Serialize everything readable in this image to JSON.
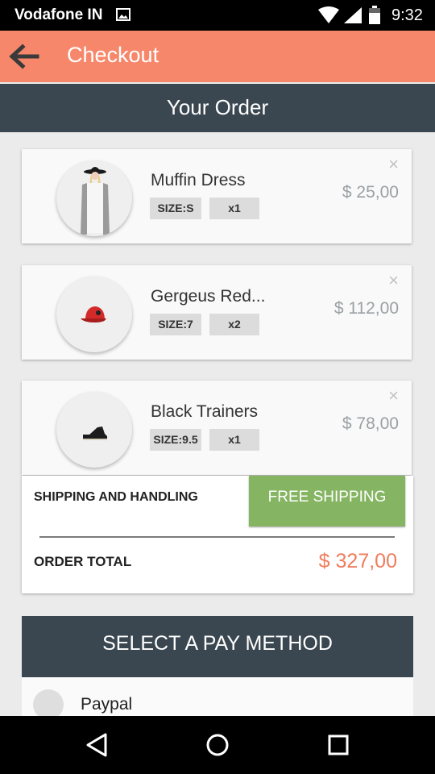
{
  "status_bar": {
    "carrier": "Vodafone IN",
    "time": "9:32"
  },
  "app_bar": {
    "title": "Checkout"
  },
  "order": {
    "heading": "Your Order",
    "items": [
      {
        "name": "Muffin Dress",
        "size": "SIZE:S",
        "qty": "x1",
        "price": "$ 25,00",
        "remove_icon": "×"
      },
      {
        "name": "Gergeus Red...",
        "size": "SIZE:7",
        "qty": "x2",
        "price": "$ 112,00",
        "remove_icon": "×"
      },
      {
        "name": "Black Trainers",
        "size": "SIZE:9.5",
        "qty": "x1",
        "price": "$ 78,00",
        "remove_icon": "×"
      }
    ]
  },
  "summary": {
    "shipping_label": "SHIPPING AND HANDLING",
    "shipping_value": "FREE SHIPPING",
    "total_label": "ORDER TOTAL",
    "total_value": "$ 327,00"
  },
  "payment": {
    "heading": "SELECT A PAY METHOD",
    "options": [
      {
        "label": "Paypal"
      }
    ]
  },
  "colors": {
    "app_bar": "#f7876b",
    "header": "#3a4750",
    "accent_total": "#f07c5c",
    "free_shipping": "#85b462"
  }
}
